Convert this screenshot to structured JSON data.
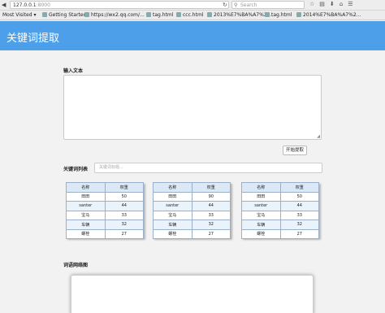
{
  "browser": {
    "url_host": "127.0.0.1",
    "url_port": ":8000",
    "search_placeholder": "Search",
    "bookmarks": [
      "Most Visited",
      "Getting Started",
      "https://wx2.qq.com/...",
      "tag.html",
      "ccc.html",
      "2013%E7%BA%A7%2...",
      "tag.html",
      "2014%E7%BA%A7%2..."
    ]
  },
  "header": {
    "title": "关键词提取"
  },
  "form": {
    "input_label": "输入文本",
    "start_button": "开始提取",
    "keyword_list_label": "关键词列表",
    "keyword_placeholder": "关键词标题...",
    "graph_label": "词语网络图"
  },
  "tables": [
    {
      "headers": [
        "名称",
        "权重"
      ],
      "rows": [
        [
          "田田",
          "50"
        ],
        [
          "santer",
          "44"
        ],
        [
          "宝马",
          "33"
        ],
        [
          "车辆",
          "32"
        ],
        [
          "螺栓",
          "27"
        ]
      ]
    },
    {
      "headers": [
        "名称",
        "权重"
      ],
      "rows": [
        [
          "田田",
          "90"
        ],
        [
          "santer",
          "44"
        ],
        [
          "宝马",
          "33"
        ],
        [
          "车辆",
          "32"
        ],
        [
          "螺栓",
          "27"
        ]
      ]
    },
    {
      "headers": [
        "名称",
        "权重"
      ],
      "rows": [
        [
          "田田",
          "50"
        ],
        [
          "santer",
          "44"
        ],
        [
          "宝马",
          "33"
        ],
        [
          "车辆",
          "32"
        ],
        [
          "螺栓",
          "27"
        ]
      ]
    }
  ]
}
